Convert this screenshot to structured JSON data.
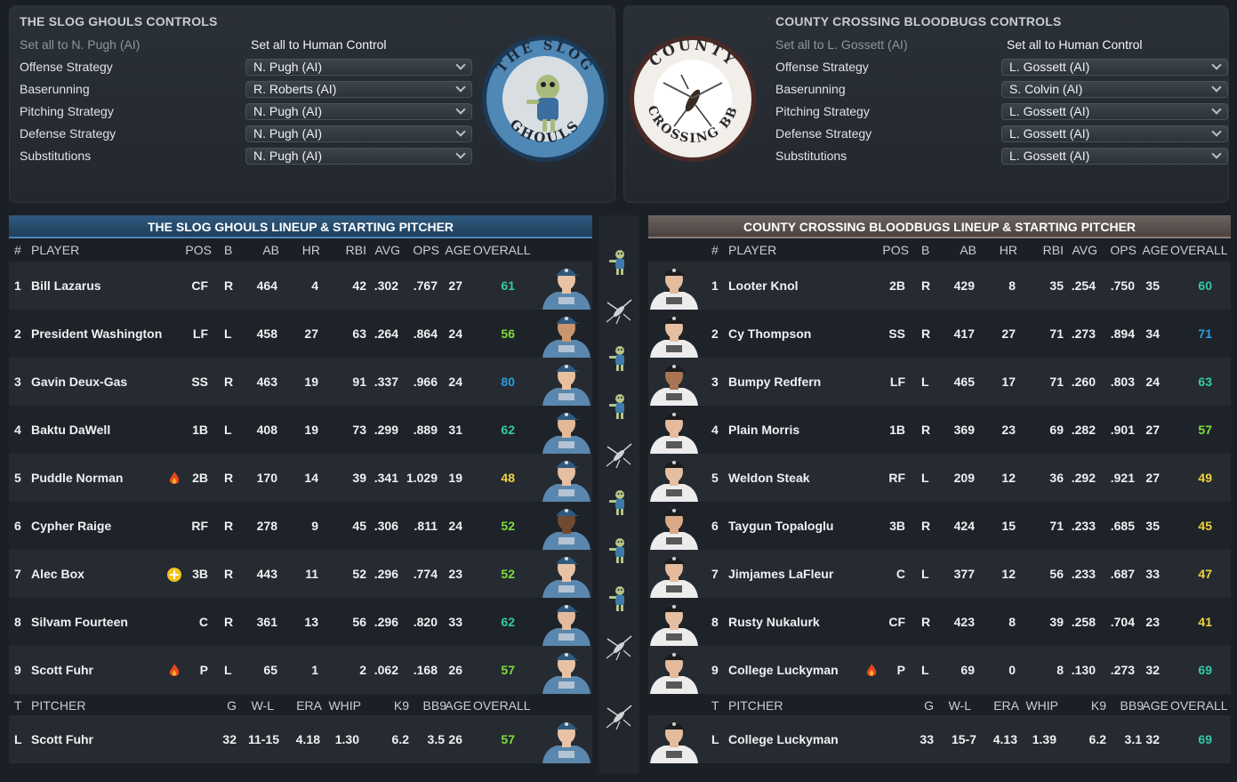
{
  "home_controls": {
    "title": "THE SLOG GHOULS CONTROLS",
    "set_all_ai": "Set all to N. Pugh (AI)",
    "set_all_human": "Set all to Human Control",
    "rows": [
      {
        "label": "Offense Strategy",
        "value": "N. Pugh (AI)"
      },
      {
        "label": "Baserunning",
        "value": "R. Roberts (AI)"
      },
      {
        "label": "Pitching Strategy",
        "value": "N. Pugh (AI)"
      },
      {
        "label": "Defense Strategy",
        "value": "N. Pugh (AI)"
      },
      {
        "label": "Substitutions",
        "value": "N. Pugh (AI)"
      }
    ],
    "logo_text_top": "THE SLOG",
    "logo_text_bottom": "GHOULS"
  },
  "away_controls": {
    "title": "COUNTY CROSSING BLOODBUGS CONTROLS",
    "set_all_ai": "Set all to L. Gossett (AI)",
    "set_all_human": "Set all to Human Control",
    "rows": [
      {
        "label": "Offense Strategy",
        "value": "L. Gossett (AI)"
      },
      {
        "label": "Baserunning",
        "value": "S. Colvin (AI)"
      },
      {
        "label": "Pitching Strategy",
        "value": "L. Gossett (AI)"
      },
      {
        "label": "Defense Strategy",
        "value": "L. Gossett (AI)"
      },
      {
        "label": "Substitutions",
        "value": "L. Gossett (AI)"
      }
    ],
    "logo_text_top": "COUNTY",
    "logo_text_bottom": "CROSSING BB"
  },
  "home_lineup": {
    "title": "THE SLOG GHOULS LINEUP & STARTING PITCHER",
    "headers": {
      "num": "#",
      "player": "PLAYER",
      "pos": "POS",
      "b": "B",
      "ab": "AB",
      "hr": "HR",
      "rbi": "RBI",
      "avg": "AVG",
      "ops": "OPS",
      "age": "AGE",
      "overall": "OVERALL"
    },
    "players": [
      {
        "num": "1",
        "name": "Bill Lazarus",
        "pos": "CF",
        "b": "R",
        "ab": "464",
        "hr": "4",
        "rbi": "42",
        "avg": ".302",
        "ops": ".767",
        "age": "27",
        "overall": "61",
        "grade": "teal",
        "badge": ""
      },
      {
        "num": "2",
        "name": "President Washington",
        "pos": "LF",
        "b": "L",
        "ab": "458",
        "hr": "27",
        "rbi": "63",
        "avg": ".264",
        "ops": ".864",
        "age": "24",
        "overall": "56",
        "grade": "green",
        "badge": ""
      },
      {
        "num": "3",
        "name": "Gavin Deux-Gas",
        "pos": "SS",
        "b": "R",
        "ab": "463",
        "hr": "19",
        "rbi": "91",
        "avg": ".337",
        "ops": ".966",
        "age": "24",
        "overall": "80",
        "grade": "blue",
        "badge": ""
      },
      {
        "num": "4",
        "name": "Baktu DaWell",
        "pos": "1B",
        "b": "L",
        "ab": "408",
        "hr": "19",
        "rbi": "73",
        "avg": ".299",
        "ops": ".889",
        "age": "31",
        "overall": "62",
        "grade": "teal",
        "badge": ""
      },
      {
        "num": "5",
        "name": "Puddle Norman",
        "pos": "2B",
        "b": "R",
        "ab": "170",
        "hr": "14",
        "rbi": "39",
        "avg": ".341",
        "ops": "1.029",
        "age": "19",
        "overall": "48",
        "grade": "yellow",
        "badge": "fire"
      },
      {
        "num": "6",
        "name": "Cypher Raige",
        "pos": "RF",
        "b": "R",
        "ab": "278",
        "hr": "9",
        "rbi": "45",
        "avg": ".306",
        "ops": ".811",
        "age": "24",
        "overall": "52",
        "grade": "green",
        "badge": ""
      },
      {
        "num": "7",
        "name": "Alec Box",
        "pos": "3B",
        "b": "R",
        "ab": "443",
        "hr": "11",
        "rbi": "52",
        "avg": ".296",
        "ops": ".774",
        "age": "23",
        "overall": "52",
        "grade": "green",
        "badge": "plus"
      },
      {
        "num": "8",
        "name": "Silvam Fourteen",
        "pos": "C",
        "b": "R",
        "ab": "361",
        "hr": "13",
        "rbi": "56",
        "avg": ".296",
        "ops": ".820",
        "age": "33",
        "overall": "62",
        "grade": "teal",
        "badge": ""
      },
      {
        "num": "9",
        "name": "Scott Fuhr",
        "pos": "P",
        "b": "L",
        "ab": "65",
        "hr": "1",
        "rbi": "2",
        "avg": ".062",
        "ops": ".168",
        "age": "26",
        "overall": "57",
        "grade": "green",
        "badge": "fire"
      }
    ],
    "pitcher_headers": {
      "t": "T",
      "pitcher": "PITCHER",
      "g": "G",
      "wl": "W-L",
      "era": "ERA",
      "whip": "WHIP",
      "k9": "K9",
      "bb9": "BB9",
      "age": "AGE",
      "overall": "OVERALL"
    },
    "pitcher": {
      "t": "L",
      "name": "Scott Fuhr",
      "g": "32",
      "wl": "11-15",
      "era": "4.18",
      "whip": "1.30",
      "k9": "6.2",
      "bb9": "3.5",
      "age": "26",
      "overall": "57",
      "grade": "green"
    }
  },
  "away_lineup": {
    "title": "COUNTY CROSSING BLOODBUGS LINEUP & STARTING PITCHER",
    "headers": {
      "num": "#",
      "player": "PLAYER",
      "pos": "POS",
      "b": "B",
      "ab": "AB",
      "hr": "HR",
      "rbi": "RBI",
      "avg": "AVG",
      "ops": "OPS",
      "age": "AGE",
      "overall": "OVERALL"
    },
    "players": [
      {
        "num": "1",
        "name": "Looter Knol",
        "pos": "2B",
        "b": "R",
        "ab": "429",
        "hr": "8",
        "rbi": "35",
        "avg": ".254",
        "ops": ".750",
        "age": "35",
        "overall": "60",
        "grade": "teal",
        "badge": ""
      },
      {
        "num": "2",
        "name": "Cy Thompson",
        "pos": "SS",
        "b": "R",
        "ab": "417",
        "hr": "27",
        "rbi": "71",
        "avg": ".273",
        "ops": ".894",
        "age": "34",
        "overall": "71",
        "grade": "blue",
        "badge": ""
      },
      {
        "num": "3",
        "name": "Bumpy Redfern",
        "pos": "LF",
        "b": "L",
        "ab": "465",
        "hr": "17",
        "rbi": "71",
        "avg": ".260",
        "ops": ".803",
        "age": "24",
        "overall": "63",
        "grade": "teal",
        "badge": ""
      },
      {
        "num": "4",
        "name": "Plain Morris",
        "pos": "1B",
        "b": "R",
        "ab": "369",
        "hr": "23",
        "rbi": "69",
        "avg": ".282",
        "ops": ".901",
        "age": "27",
        "overall": "57",
        "grade": "green",
        "badge": ""
      },
      {
        "num": "5",
        "name": "Weldon Steak",
        "pos": "RF",
        "b": "L",
        "ab": "209",
        "hr": "12",
        "rbi": "36",
        "avg": ".292",
        "ops": ".921",
        "age": "27",
        "overall": "49",
        "grade": "yellow",
        "badge": ""
      },
      {
        "num": "6",
        "name": "Taygun Topaloglu",
        "pos": "3B",
        "b": "R",
        "ab": "424",
        "hr": "15",
        "rbi": "71",
        "avg": ".233",
        "ops": ".685",
        "age": "35",
        "overall": "45",
        "grade": "yellow",
        "badge": ""
      },
      {
        "num": "7",
        "name": "Jimjames LaFleur",
        "pos": "C",
        "b": "L",
        "ab": "377",
        "hr": "12",
        "rbi": "56",
        "avg": ".233",
        "ops": ".687",
        "age": "33",
        "overall": "47",
        "grade": "yellow",
        "badge": ""
      },
      {
        "num": "8",
        "name": "Rusty Nukalurk",
        "pos": "CF",
        "b": "R",
        "ab": "423",
        "hr": "8",
        "rbi": "39",
        "avg": ".258",
        "ops": ".704",
        "age": "23",
        "overall": "41",
        "grade": "yellow",
        "badge": ""
      },
      {
        "num": "9",
        "name": "College Luckyman",
        "pos": "P",
        "b": "L",
        "ab": "69",
        "hr": "0",
        "rbi": "8",
        "avg": ".130",
        "ops": ".273",
        "age": "32",
        "overall": "69",
        "grade": "teal",
        "badge": "fire"
      }
    ],
    "pitcher_headers": {
      "t": "T",
      "pitcher": "PITCHER",
      "g": "G",
      "wl": "W-L",
      "era": "ERA",
      "whip": "WHIP",
      "k9": "K9",
      "bb9": "BB9",
      "age": "AGE",
      "overall": "OVERALL"
    },
    "pitcher": {
      "t": "L",
      "name": "College Luckyman",
      "g": "33",
      "wl": "15-7",
      "era": "4.13",
      "whip": "1.39",
      "k9": "6.2",
      "bb9": "3.1",
      "age": "32",
      "overall": "69",
      "grade": "teal"
    }
  },
  "matchup_icons": [
    "ghoul-icon",
    "mosquito-icon",
    "ghoul-icon",
    "ghoul-icon",
    "mosquito-icon",
    "ghoul-icon",
    "ghoul-icon",
    "ghoul-icon",
    "mosquito-icon",
    "mosquito-icon"
  ],
  "colors": {
    "home_accent": "#2f5a7f",
    "away_accent": "#6d6360",
    "green": "#7fdc3c",
    "teal": "#35c9a7",
    "blue": "#2f9be0",
    "yellow": "#f0d23c"
  }
}
